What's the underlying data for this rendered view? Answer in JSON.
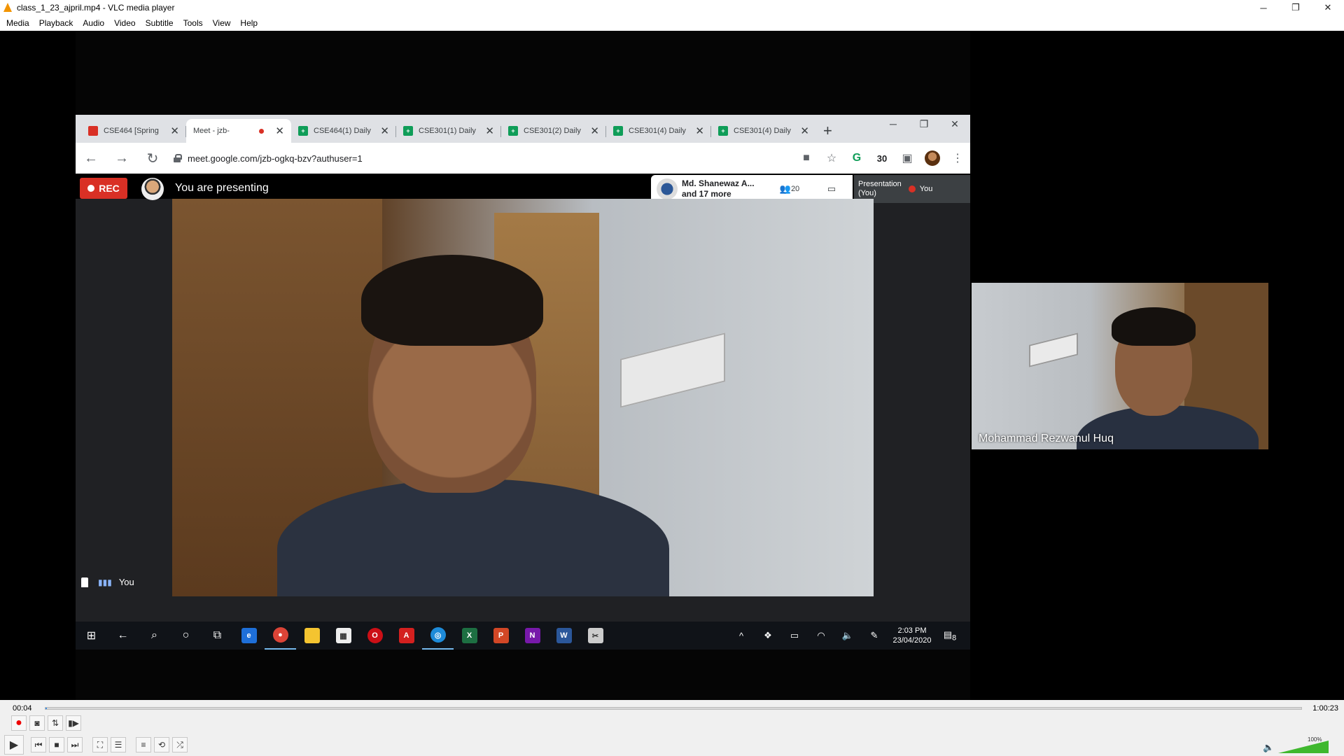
{
  "window": {
    "title": "class_1_23_ajpril.mp4 - VLC media player",
    "minimize": "─",
    "restore": "❐",
    "close": "✕"
  },
  "menubar": {
    "items": [
      "Media",
      "Playback",
      "Audio",
      "Video",
      "Subtitle",
      "Tools",
      "View",
      "Help"
    ]
  },
  "browser": {
    "tabs": [
      {
        "title": "CSE464 [Spring",
        "icon": "classroom-icon"
      },
      {
        "title": "Meet - jzb-",
        "icon": "meet-icon",
        "active": true
      },
      {
        "title": "CSE464(1) Daily",
        "icon": "sheets-icon"
      },
      {
        "title": "CSE301(1) Daily",
        "icon": "sheets-icon"
      },
      {
        "title": "CSE301(2) Daily",
        "icon": "sheets-icon"
      },
      {
        "title": "CSE301(4) Daily",
        "icon": "sheets-icon"
      },
      {
        "title": "CSE301(4) Daily",
        "icon": "sheets-icon"
      }
    ],
    "new_tab": "+",
    "url": "meet.google.com/jzb-ogkq-bzv?authuser=1",
    "extension_count": "30"
  },
  "meet": {
    "rec_label": "REC",
    "presenting_text": "You are presenting",
    "participants_name": "Md. Shanewaz A...",
    "participants_more": "and 17 more",
    "people_count": "20",
    "presentation_tile_line1": "Presentation",
    "presentation_tile_line2": "(You)",
    "tile_you_label": "You",
    "self_label": "You"
  },
  "taskbar": {
    "time": "2:03 PM",
    "date": "23/04/2020",
    "notification_count": "8"
  },
  "pip": {
    "name": "Mohammad Rezwanul Huq"
  },
  "player": {
    "time_current": "00:04",
    "time_total": "1:00:23",
    "progress_fraction": 0.001,
    "volume_percent": "100%",
    "accent": "#3a8ee6"
  }
}
